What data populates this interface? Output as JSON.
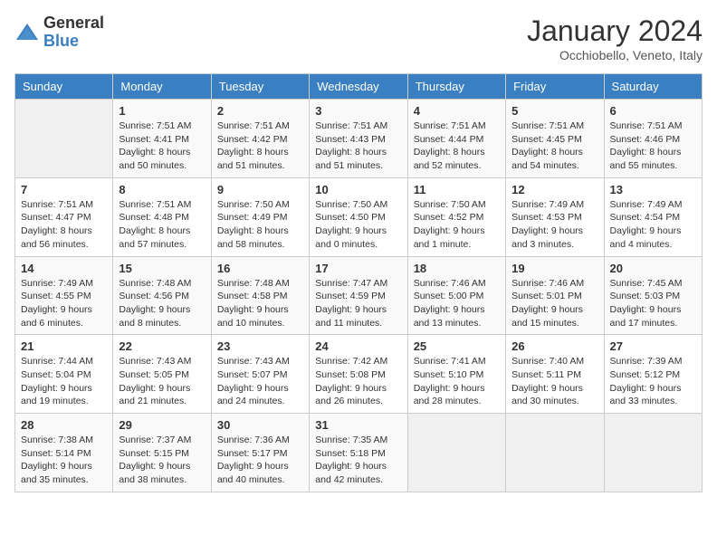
{
  "header": {
    "logo_general": "General",
    "logo_blue": "Blue",
    "title": "January 2024",
    "location": "Occhiobello, Veneto, Italy"
  },
  "days_of_week": [
    "Sunday",
    "Monday",
    "Tuesday",
    "Wednesday",
    "Thursday",
    "Friday",
    "Saturday"
  ],
  "weeks": [
    [
      {
        "day": "",
        "info": ""
      },
      {
        "day": "1",
        "info": "Sunrise: 7:51 AM\nSunset: 4:41 PM\nDaylight: 8 hours\nand 50 minutes."
      },
      {
        "day": "2",
        "info": "Sunrise: 7:51 AM\nSunset: 4:42 PM\nDaylight: 8 hours\nand 51 minutes."
      },
      {
        "day": "3",
        "info": "Sunrise: 7:51 AM\nSunset: 4:43 PM\nDaylight: 8 hours\nand 51 minutes."
      },
      {
        "day": "4",
        "info": "Sunrise: 7:51 AM\nSunset: 4:44 PM\nDaylight: 8 hours\nand 52 minutes."
      },
      {
        "day": "5",
        "info": "Sunrise: 7:51 AM\nSunset: 4:45 PM\nDaylight: 8 hours\nand 54 minutes."
      },
      {
        "day": "6",
        "info": "Sunrise: 7:51 AM\nSunset: 4:46 PM\nDaylight: 8 hours\nand 55 minutes."
      }
    ],
    [
      {
        "day": "7",
        "info": "Sunrise: 7:51 AM\nSunset: 4:47 PM\nDaylight: 8 hours\nand 56 minutes."
      },
      {
        "day": "8",
        "info": "Sunrise: 7:51 AM\nSunset: 4:48 PM\nDaylight: 8 hours\nand 57 minutes."
      },
      {
        "day": "9",
        "info": "Sunrise: 7:50 AM\nSunset: 4:49 PM\nDaylight: 8 hours\nand 58 minutes."
      },
      {
        "day": "10",
        "info": "Sunrise: 7:50 AM\nSunset: 4:50 PM\nDaylight: 9 hours\nand 0 minutes."
      },
      {
        "day": "11",
        "info": "Sunrise: 7:50 AM\nSunset: 4:52 PM\nDaylight: 9 hours\nand 1 minute."
      },
      {
        "day": "12",
        "info": "Sunrise: 7:49 AM\nSunset: 4:53 PM\nDaylight: 9 hours\nand 3 minutes."
      },
      {
        "day": "13",
        "info": "Sunrise: 7:49 AM\nSunset: 4:54 PM\nDaylight: 9 hours\nand 4 minutes."
      }
    ],
    [
      {
        "day": "14",
        "info": "Sunrise: 7:49 AM\nSunset: 4:55 PM\nDaylight: 9 hours\nand 6 minutes."
      },
      {
        "day": "15",
        "info": "Sunrise: 7:48 AM\nSunset: 4:56 PM\nDaylight: 9 hours\nand 8 minutes."
      },
      {
        "day": "16",
        "info": "Sunrise: 7:48 AM\nSunset: 4:58 PM\nDaylight: 9 hours\nand 10 minutes."
      },
      {
        "day": "17",
        "info": "Sunrise: 7:47 AM\nSunset: 4:59 PM\nDaylight: 9 hours\nand 11 minutes."
      },
      {
        "day": "18",
        "info": "Sunrise: 7:46 AM\nSunset: 5:00 PM\nDaylight: 9 hours\nand 13 minutes."
      },
      {
        "day": "19",
        "info": "Sunrise: 7:46 AM\nSunset: 5:01 PM\nDaylight: 9 hours\nand 15 minutes."
      },
      {
        "day": "20",
        "info": "Sunrise: 7:45 AM\nSunset: 5:03 PM\nDaylight: 9 hours\nand 17 minutes."
      }
    ],
    [
      {
        "day": "21",
        "info": "Sunrise: 7:44 AM\nSunset: 5:04 PM\nDaylight: 9 hours\nand 19 minutes."
      },
      {
        "day": "22",
        "info": "Sunrise: 7:43 AM\nSunset: 5:05 PM\nDaylight: 9 hours\nand 21 minutes."
      },
      {
        "day": "23",
        "info": "Sunrise: 7:43 AM\nSunset: 5:07 PM\nDaylight: 9 hours\nand 24 minutes."
      },
      {
        "day": "24",
        "info": "Sunrise: 7:42 AM\nSunset: 5:08 PM\nDaylight: 9 hours\nand 26 minutes."
      },
      {
        "day": "25",
        "info": "Sunrise: 7:41 AM\nSunset: 5:10 PM\nDaylight: 9 hours\nand 28 minutes."
      },
      {
        "day": "26",
        "info": "Sunrise: 7:40 AM\nSunset: 5:11 PM\nDaylight: 9 hours\nand 30 minutes."
      },
      {
        "day": "27",
        "info": "Sunrise: 7:39 AM\nSunset: 5:12 PM\nDaylight: 9 hours\nand 33 minutes."
      }
    ],
    [
      {
        "day": "28",
        "info": "Sunrise: 7:38 AM\nSunset: 5:14 PM\nDaylight: 9 hours\nand 35 minutes."
      },
      {
        "day": "29",
        "info": "Sunrise: 7:37 AM\nSunset: 5:15 PM\nDaylight: 9 hours\nand 38 minutes."
      },
      {
        "day": "30",
        "info": "Sunrise: 7:36 AM\nSunset: 5:17 PM\nDaylight: 9 hours\nand 40 minutes."
      },
      {
        "day": "31",
        "info": "Sunrise: 7:35 AM\nSunset: 5:18 PM\nDaylight: 9 hours\nand 42 minutes."
      },
      {
        "day": "",
        "info": ""
      },
      {
        "day": "",
        "info": ""
      },
      {
        "day": "",
        "info": ""
      }
    ]
  ]
}
